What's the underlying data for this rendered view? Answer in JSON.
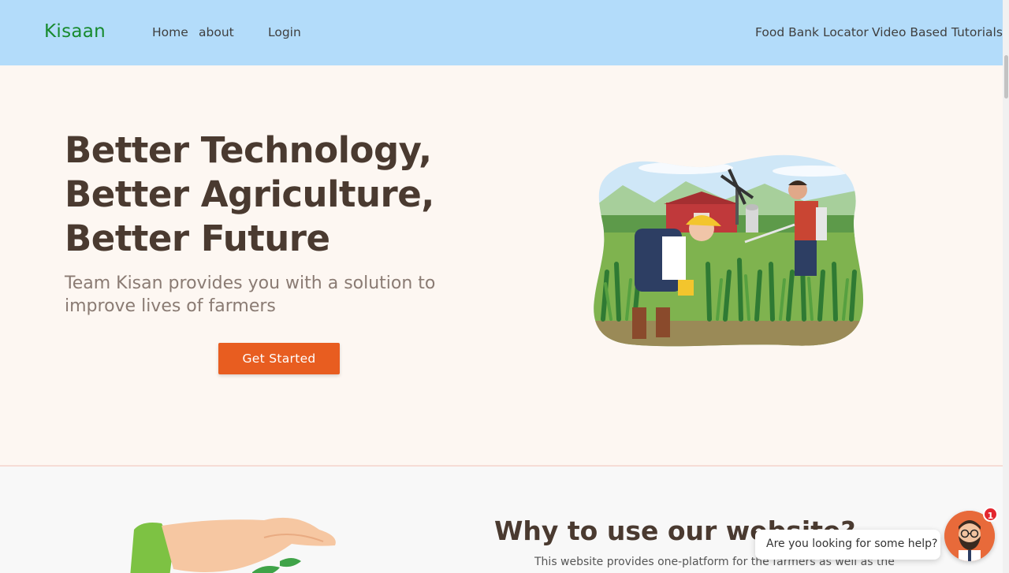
{
  "navbar": {
    "brand": "Kisaan",
    "links": [
      "Home",
      "about",
      "Login"
    ],
    "right_links": [
      "Food Bank Locator",
      "Video Based Tutorials"
    ],
    "background": "#b3dcfa",
    "brand_color": "#178a2e"
  },
  "hero": {
    "title_lines": [
      "Better Technology,",
      "Better Agriculture,",
      "Better Future"
    ],
    "subtitle": "Team Kisan provides you with a solution to improve lives of farmers",
    "cta_label": "Get Started",
    "cta_color": "#e85d20",
    "illustration": "farmers-in-field-illustration"
  },
  "section2": {
    "title": "Why to use our website?",
    "text": "This website provides one-platform for the farmers as well as the",
    "illustration": "hand-with-plant-illustration"
  },
  "chat": {
    "prompt": "Are you looking for some help?",
    "badge_count": "1",
    "avatar_icon": "bearded-man-avatar-icon"
  }
}
